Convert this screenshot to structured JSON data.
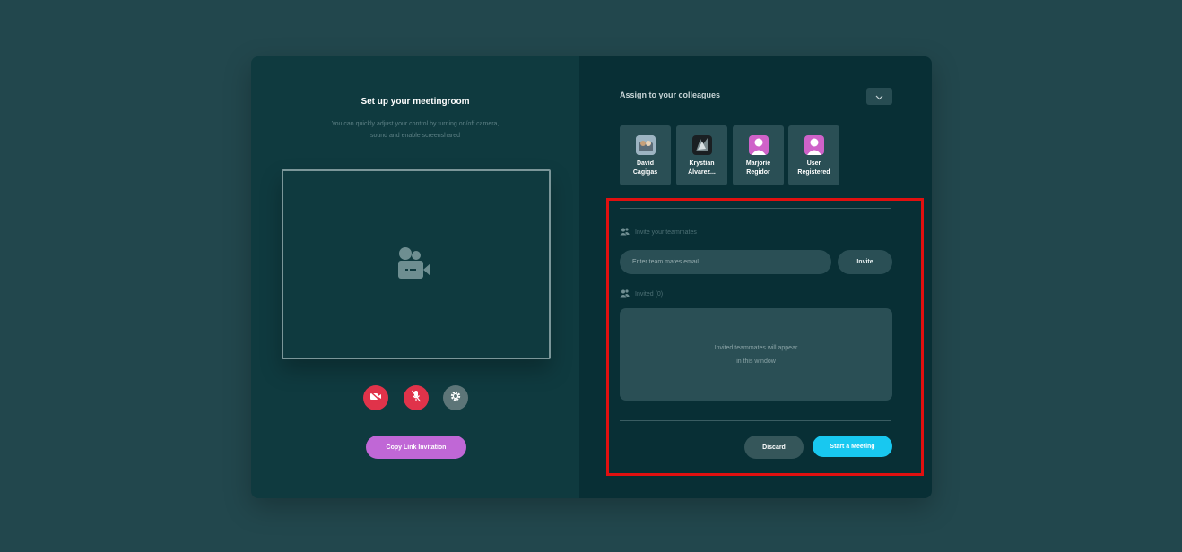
{
  "setup": {
    "title": "Set up your meetingroom",
    "subtitle": "You can quickly adjust your control by turning on/off camera, sound and enable screenshared",
    "copy_link_label": "Copy Link Invitation"
  },
  "assign": {
    "title": "Assign to your colleagues",
    "colleagues": [
      {
        "line1": "David",
        "line2": "Cagigas"
      },
      {
        "line1": "Krystian",
        "line2": "Álvarez..."
      },
      {
        "line1": "Marjorie",
        "line2": "Regidor"
      },
      {
        "line1": "User",
        "line2": "Registered"
      }
    ]
  },
  "invite": {
    "section_label": "Invite your teammates",
    "email_placeholder": "Enter team mates email",
    "invite_label": "Invite",
    "invited_label": "Invited (0)",
    "empty_line1": "Invited teammates will appear",
    "empty_line2": "in this window"
  },
  "actions": {
    "discard_label": "Discard",
    "start_label": "Start a Meeting"
  },
  "colors": {
    "page_bg": "#22474d",
    "accent_cyan": "#18c8f0",
    "accent_purple": "#c067d6",
    "danger_red": "#e0334a",
    "highlight_red": "#e01010"
  }
}
